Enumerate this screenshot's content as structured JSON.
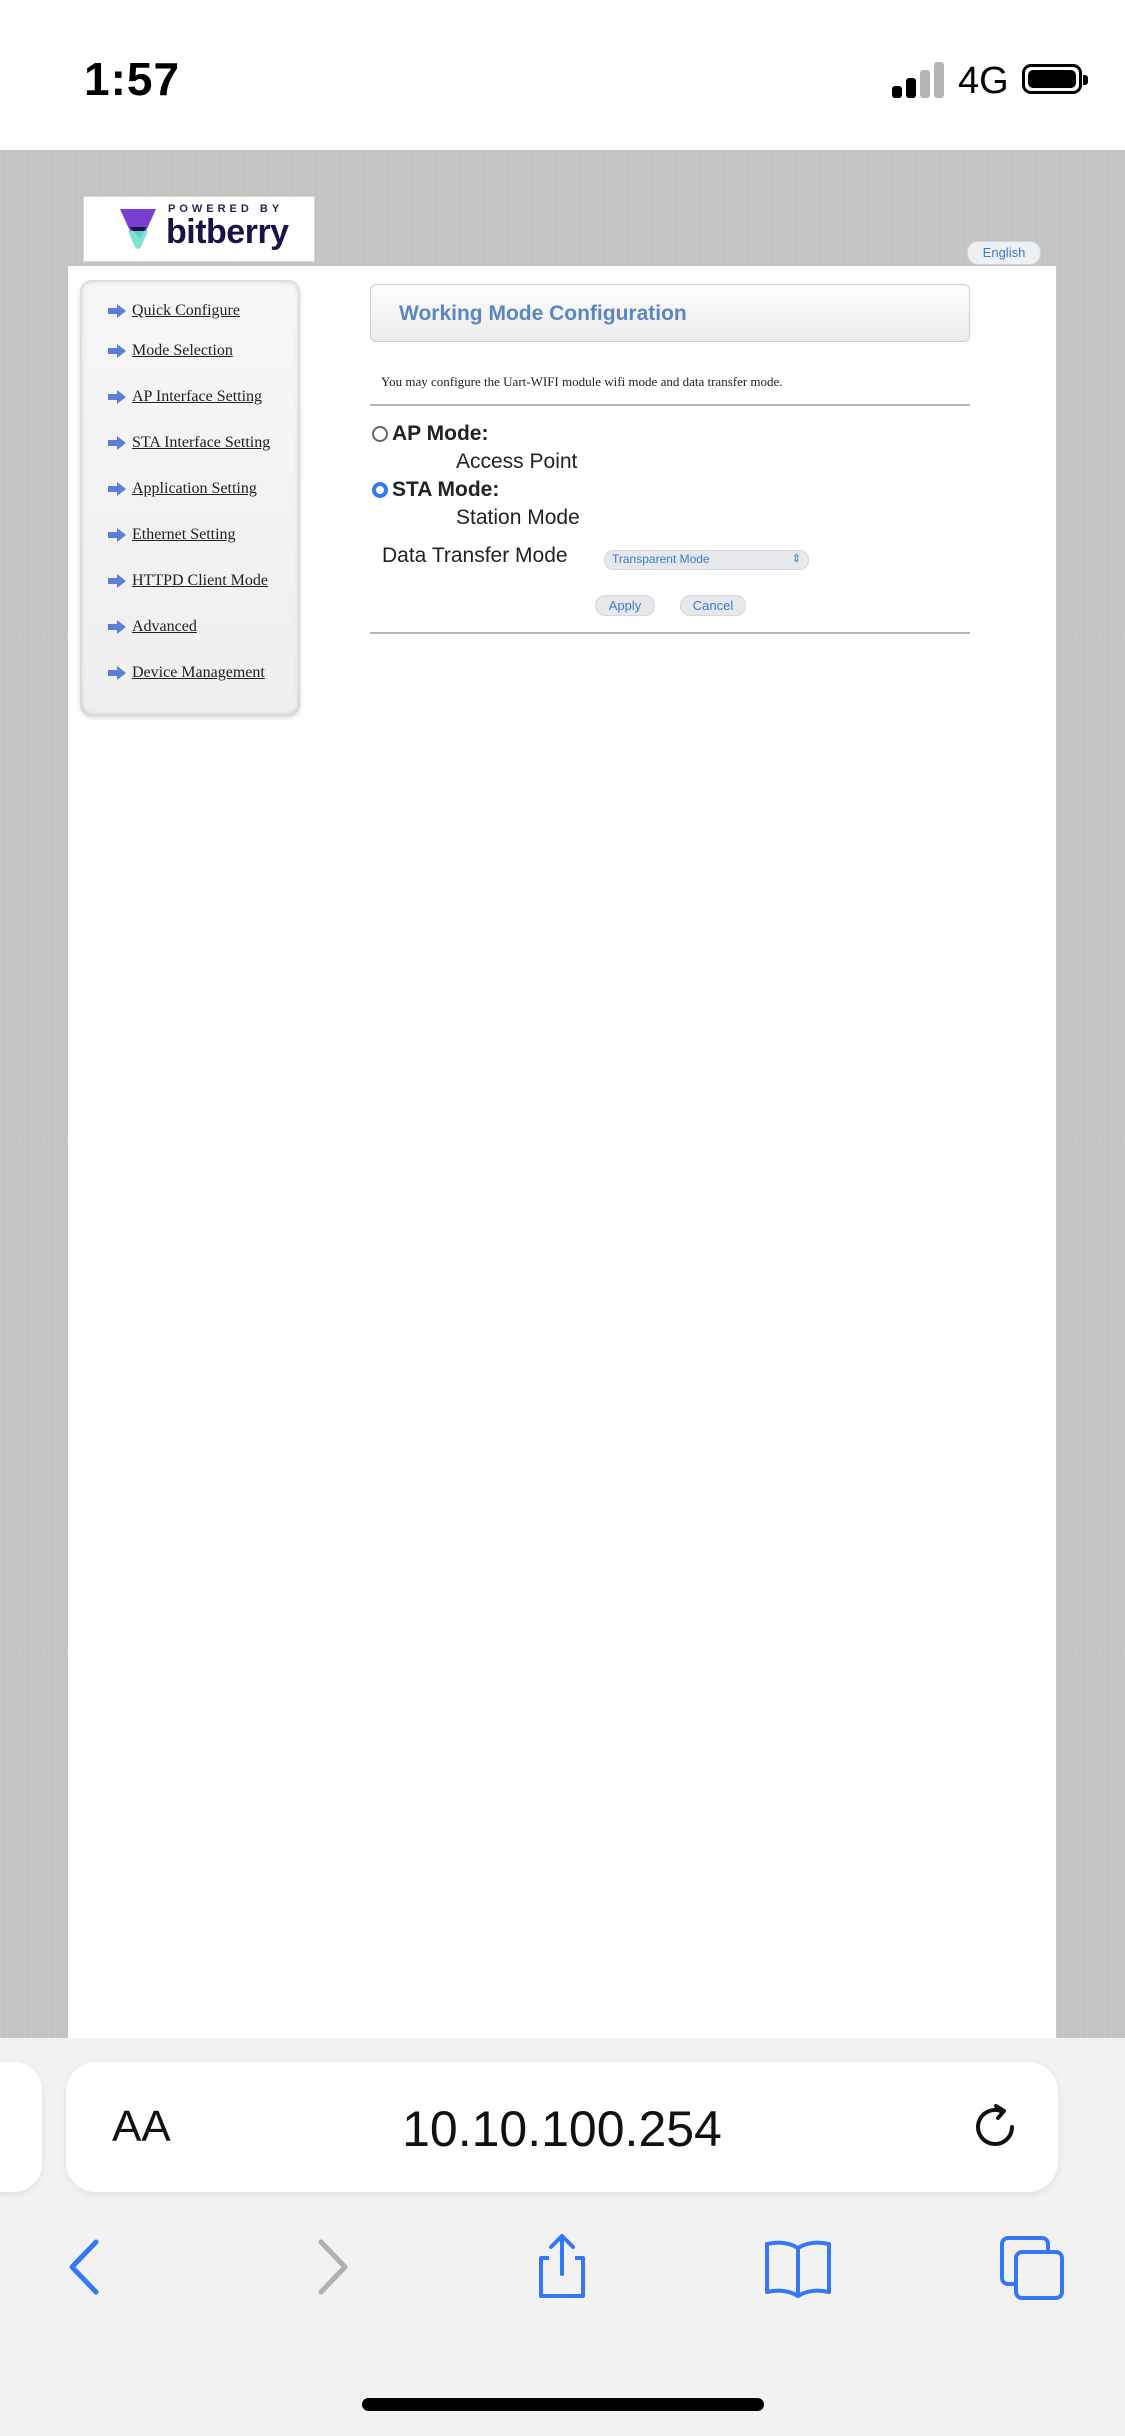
{
  "status_bar": {
    "time": "1:57",
    "network": "4G",
    "signal_bars_active": 2,
    "signal_bars_total": 4
  },
  "logo": {
    "powered_by": "POWERED BY",
    "brand": "bitberry"
  },
  "language_button": "English",
  "sidebar": {
    "items": [
      {
        "label": "Quick Configure"
      },
      {
        "label": "Mode Selection"
      },
      {
        "label": "AP Interface Setting"
      },
      {
        "label": "STA Interface Setting"
      },
      {
        "label": "Application Setting"
      },
      {
        "label": "Ethernet Setting"
      },
      {
        "label": "HTTPD Client Mode"
      },
      {
        "label": "Advanced"
      },
      {
        "label": "Device Management"
      }
    ]
  },
  "main": {
    "title": "Working Mode Configuration",
    "description": "You may configure the Uart-WIFI module wifi mode and data transfer mode.",
    "modes": [
      {
        "label": "AP Mode:",
        "description": "Access Point",
        "selected": false
      },
      {
        "label": "STA Mode:",
        "description": "Station Mode",
        "selected": true
      }
    ],
    "data_transfer_label": "Data Transfer Mode",
    "data_transfer_value": "Transparent Mode",
    "apply_label": "Apply",
    "cancel_label": "Cancel"
  },
  "browser": {
    "text_size_label": "AA",
    "url": "10.10.100.254"
  },
  "colors": {
    "accent_blue": "#3478f6",
    "header_text": "#5a86c4",
    "page_background": "#c3c3c3"
  }
}
